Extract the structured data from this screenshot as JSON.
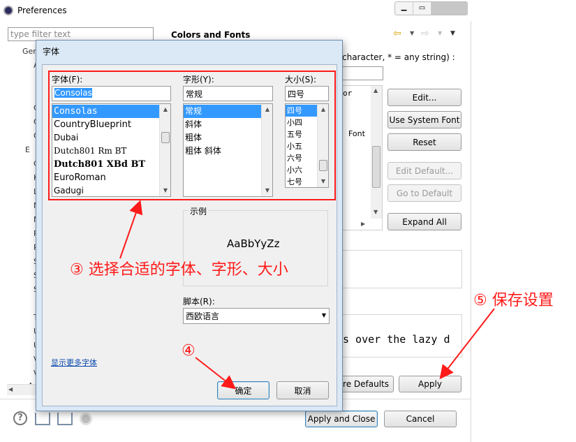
{
  "preferences": {
    "title": "Preferences",
    "filter_placeholder": "type filter text",
    "page_title": "Colors and Fonts",
    "desc_fragment": "character, * = any string) :",
    "tree_fragments": [
      "Gen",
      "A",
      "C",
      "C",
      "C",
      "E",
      "C",
      "K",
      "L",
      "N",
      "N",
      "P",
      "R",
      "S",
      "S",
      "S",
      "T",
      "U",
      "U",
      "V",
      "V",
      "A"
    ],
    "right_fragments": {
      "or": "or",
      "font": "Font",
      "preview_text": "s over the lazy d"
    },
    "buttons": {
      "edit": "Edit...",
      "use_system_font": "Use System Font",
      "reset": "Reset",
      "edit_default": "Edit Default...",
      "go_to_default": "Go to Default",
      "expand_all": "Expand All",
      "restore_defaults": "ore Defaults",
      "apply": "Apply",
      "apply_and_close": "Apply and Close",
      "cancel": "Cancel"
    }
  },
  "font_dialog": {
    "title": "字体",
    "font_label": "字体(F):",
    "font_value": "Consolas",
    "fonts": [
      {
        "name": "Consolas",
        "selected": true
      },
      {
        "name": "CountryBlueprint"
      },
      {
        "name": "Dubai"
      },
      {
        "name": "Dutch801 Rm BT"
      },
      {
        "name": "Dutch801 XBd BT"
      },
      {
        "name": "EuroRoman"
      },
      {
        "name": "Gadugi"
      }
    ],
    "style_label": "字形(Y):",
    "style_value": "常规",
    "styles": [
      {
        "name": "常规",
        "selected": true
      },
      {
        "name": "斜体"
      },
      {
        "name": "粗体"
      },
      {
        "name": "粗体 斜体"
      }
    ],
    "size_label": "大小(S):",
    "size_value": "四号",
    "sizes": [
      {
        "name": "四号",
        "selected": true
      },
      {
        "name": "小四"
      },
      {
        "name": "五号"
      },
      {
        "name": "小五"
      },
      {
        "name": "六号"
      },
      {
        "name": "小六"
      },
      {
        "name": "七号"
      }
    ],
    "sample_label": "示例",
    "sample_text": "AaBbYyZz",
    "script_label": "脚本(R):",
    "script_value": "西欧语言",
    "more_fonts_link": "显示更多字体",
    "ok": "确定",
    "cancel": "取消"
  },
  "annotations": {
    "step3": "③ 选择合适的字体、字形、大小",
    "step4": "④",
    "step5": "⑤ 保存设置",
    "color": "#ff1a1a"
  }
}
